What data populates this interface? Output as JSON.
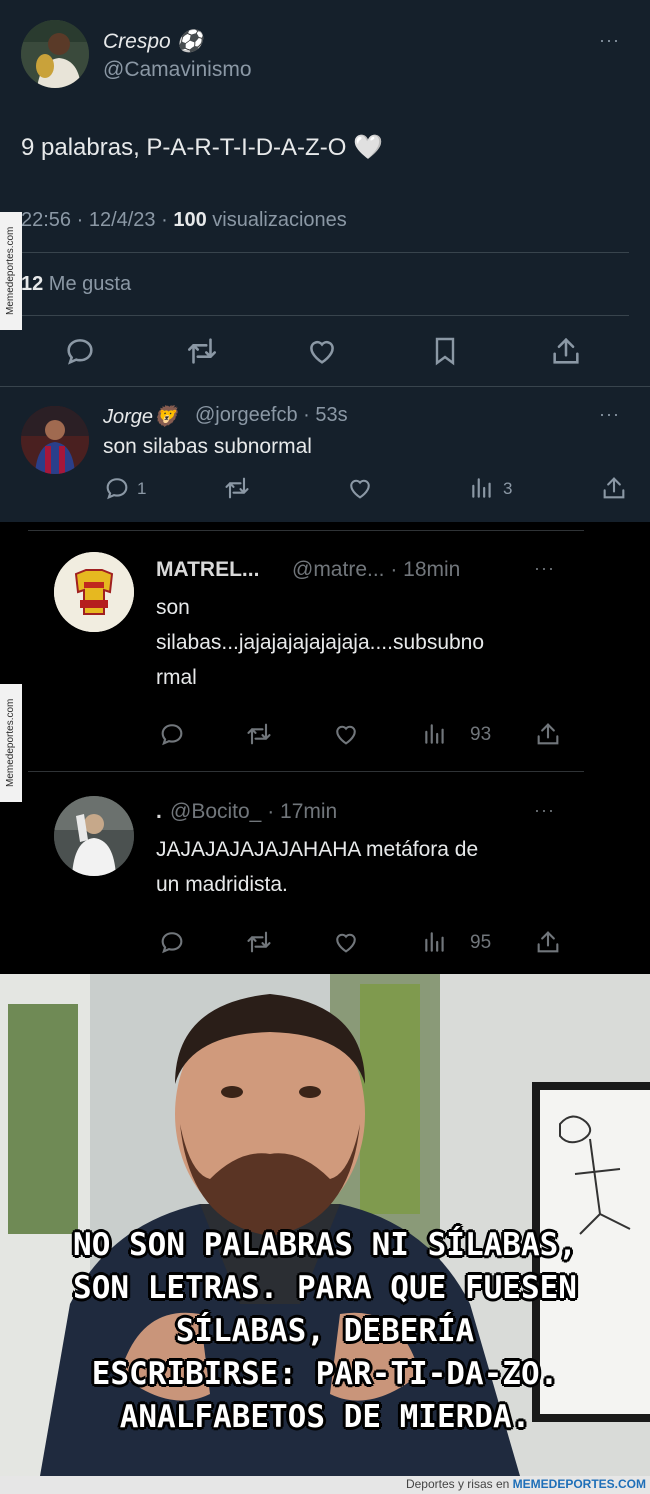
{
  "tweet": {
    "display_name": "Crespo ⚽",
    "handle": "@Camavinismo",
    "text": "9 palabras, P-A-R-T-I-D-A-Z-O 🤍",
    "time": "22:56 · 12/4/23 · ",
    "views_count": "100",
    "views_label": " visualizaciones",
    "likes_count": "12",
    "likes_label": " Me gusta",
    "more": "···"
  },
  "reply1": {
    "display_name": "Jorge🦁",
    "meta": "@jorgeefcb · 53s",
    "text": "son silabas subnormal",
    "replies": "1",
    "views": "3",
    "more": "···"
  },
  "reply2": {
    "display_name": "MATREL...",
    "meta": "@matre... · 18min",
    "text_lines": [
      "son",
      "silabas...jajajajajajajaja....subsubno",
      "rmal"
    ],
    "views": "93",
    "more": "···"
  },
  "reply3": {
    "display_name": ".",
    "meta": "@Bocito_ · 17min",
    "text_lines": [
      "JAJAJAJAJAJAHAHA metáfora de",
      "un madridista."
    ],
    "views": "95",
    "more": "···"
  },
  "meme": {
    "caption_lines": [
      "NO SON PALABRAS NI SÍLABAS,",
      "SON LETRAS. PARA QUE FUESEN",
      "SÍLABAS, DEBERÍA",
      "ESCRIBIRSE: PAR-TI-DA-ZO.",
      "ANALFABETOS DE MIERDA."
    ]
  },
  "watermark": {
    "side": "Memedeportes.com",
    "footer_prefix": "Deportes y risas en ",
    "footer_brand": "MEMEDEPORTES.COM"
  },
  "colors": {
    "dim_bg": "#15202b",
    "black_bg": "#000000",
    "muted_text": "#8b98a5",
    "divider": "#38444d"
  },
  "icons": [
    "reply-icon",
    "retweet-icon",
    "like-icon",
    "bookmark-icon",
    "share-icon",
    "views-icon",
    "more-icon"
  ]
}
